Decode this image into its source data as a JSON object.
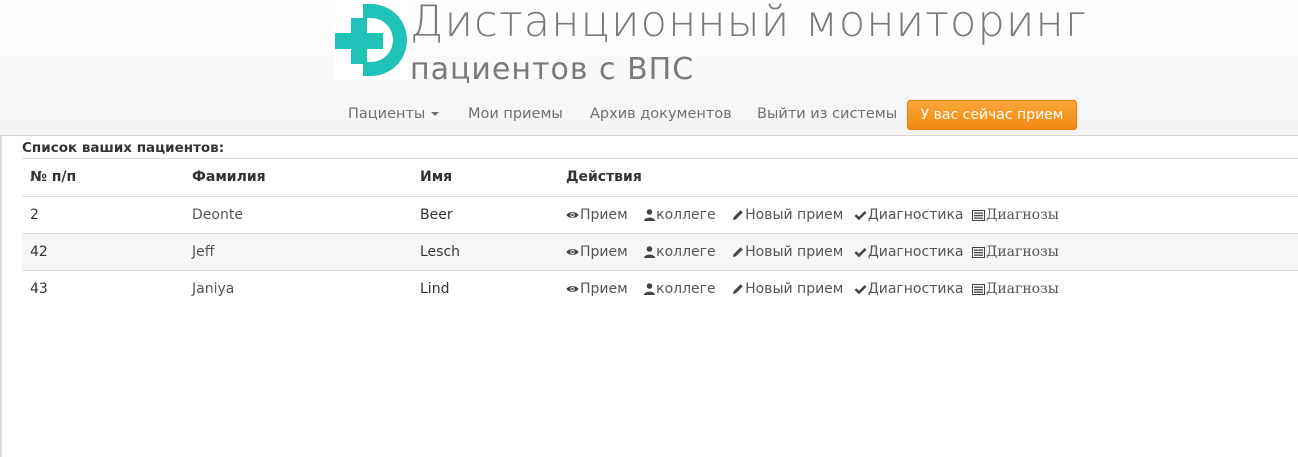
{
  "header": {
    "title": "Дистанционный мониторинг",
    "subtitle": "пациентов с ВПС",
    "logo_colors": {
      "primary": "#1fc2b7",
      "background": "#ffffff"
    }
  },
  "nav": {
    "patients": "Пациенты",
    "my_appointments": "Мои приемы",
    "archive": "Архив документов",
    "logout": "Выйти из системы",
    "current_appointment": "У вас сейчас прием"
  },
  "main": {
    "heading": "Список ваших пациентов:",
    "columns": [
      "№ п/п",
      "Фамилия",
      "Имя",
      "Действия"
    ],
    "rows": [
      {
        "num": "2",
        "last": "Deonte",
        "first": "Beer"
      },
      {
        "num": "42",
        "last": "Jeff",
        "first": "Lesch"
      },
      {
        "num": "43",
        "last": "Janiya",
        "first": "Lind"
      }
    ],
    "actions": {
      "view": "Прием",
      "colleague": "коллеге",
      "new_appointment": "Новый прием",
      "diagnostics": "Диагностика",
      "diagnoses": "Диагнозы"
    },
    "action_icons": [
      "eye-icon",
      "user-icon",
      "pencil-icon",
      "check-icon",
      "list-alt-icon"
    ]
  },
  "colors": {
    "accent_button": "#f7961f",
    "header_text": "#7a7a7a",
    "nav_text": "#707070"
  }
}
